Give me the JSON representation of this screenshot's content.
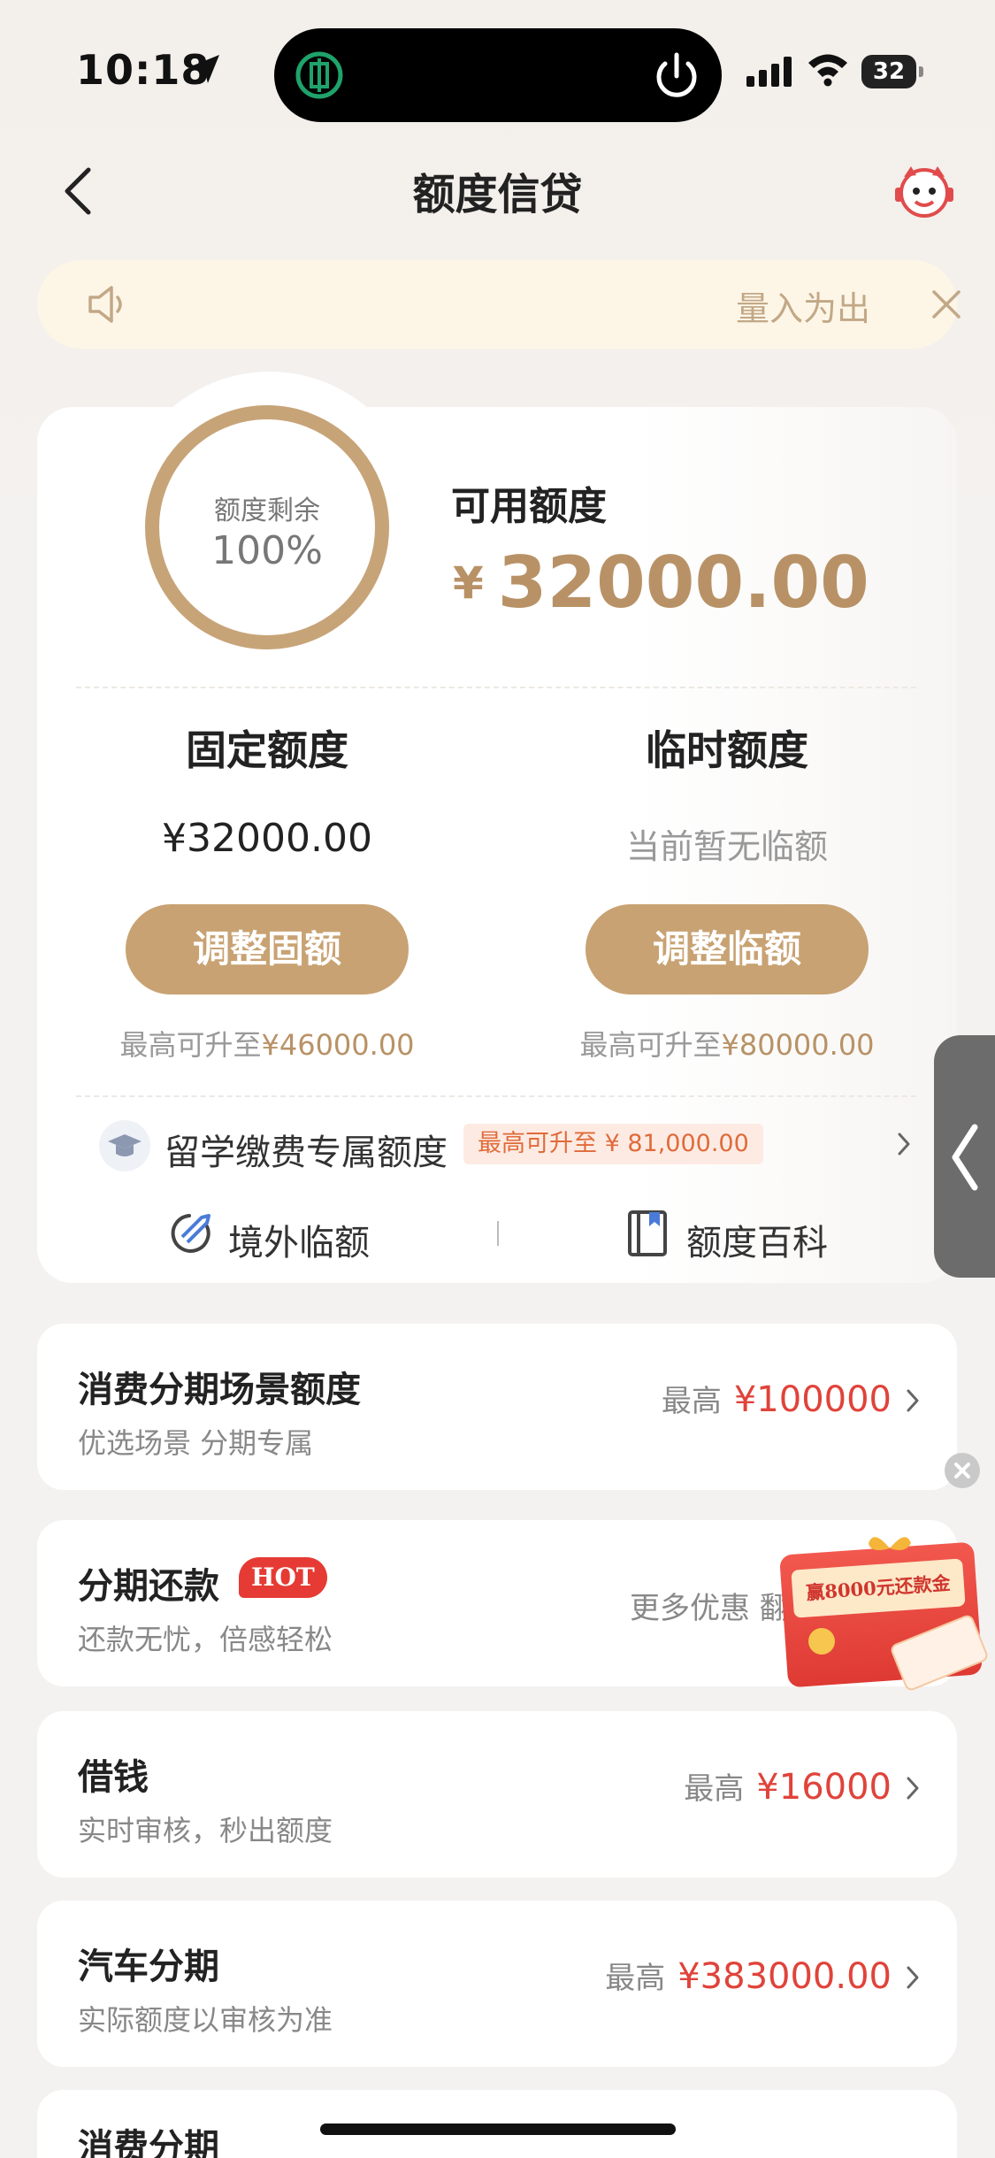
{
  "status_bar": {
    "time": "10:18",
    "battery": "32"
  },
  "nav": {
    "title": "额度信贷"
  },
  "notice": {
    "text": "量入为出"
  },
  "credit": {
    "ring_label": "额度剩余",
    "ring_value": "100%",
    "remaining_fraction": 1.0,
    "available_label": "可用额度",
    "available_currency": "¥",
    "available_amount": "32000.00"
  },
  "fixed": {
    "title": "固定额度",
    "value": "¥32000.00",
    "button": "调整固额",
    "hint_prefix": "最高可升至",
    "hint_amount": "¥46000.00"
  },
  "temp": {
    "title": "临时额度",
    "value": "当前暂无临额",
    "button": "调整临额",
    "hint_prefix": "最高可升至",
    "hint_amount": "¥80000.00"
  },
  "study": {
    "label": "留学缴费专属额度",
    "tag": "最高可升至 ¥ 81,000.00"
  },
  "quick_links": {
    "overseas": "境外临额",
    "wiki": "额度百科"
  },
  "list": [
    {
      "title": "消费分期场景额度",
      "sub": "优选场景 分期专属",
      "pre": "最高",
      "value": "¥100000"
    },
    {
      "title": "分期还款",
      "badge": "HOT",
      "sub": "还款无忧，倍感轻松",
      "more": "更多优惠 翻"
    },
    {
      "title": "借钱",
      "sub": "实时审核，秒出额度",
      "pre": "最高",
      "value": "¥16000"
    },
    {
      "title": "汽车分期",
      "sub": "实际额度以审核为准",
      "pre": "最高",
      "value": "¥383000.00"
    },
    {
      "title": "消费分期"
    }
  ],
  "promo": {
    "banner": "赢8000元还款金"
  },
  "colors": {
    "gold": "#c8a273",
    "red": "#e0433a",
    "hot": "#e53b34"
  }
}
